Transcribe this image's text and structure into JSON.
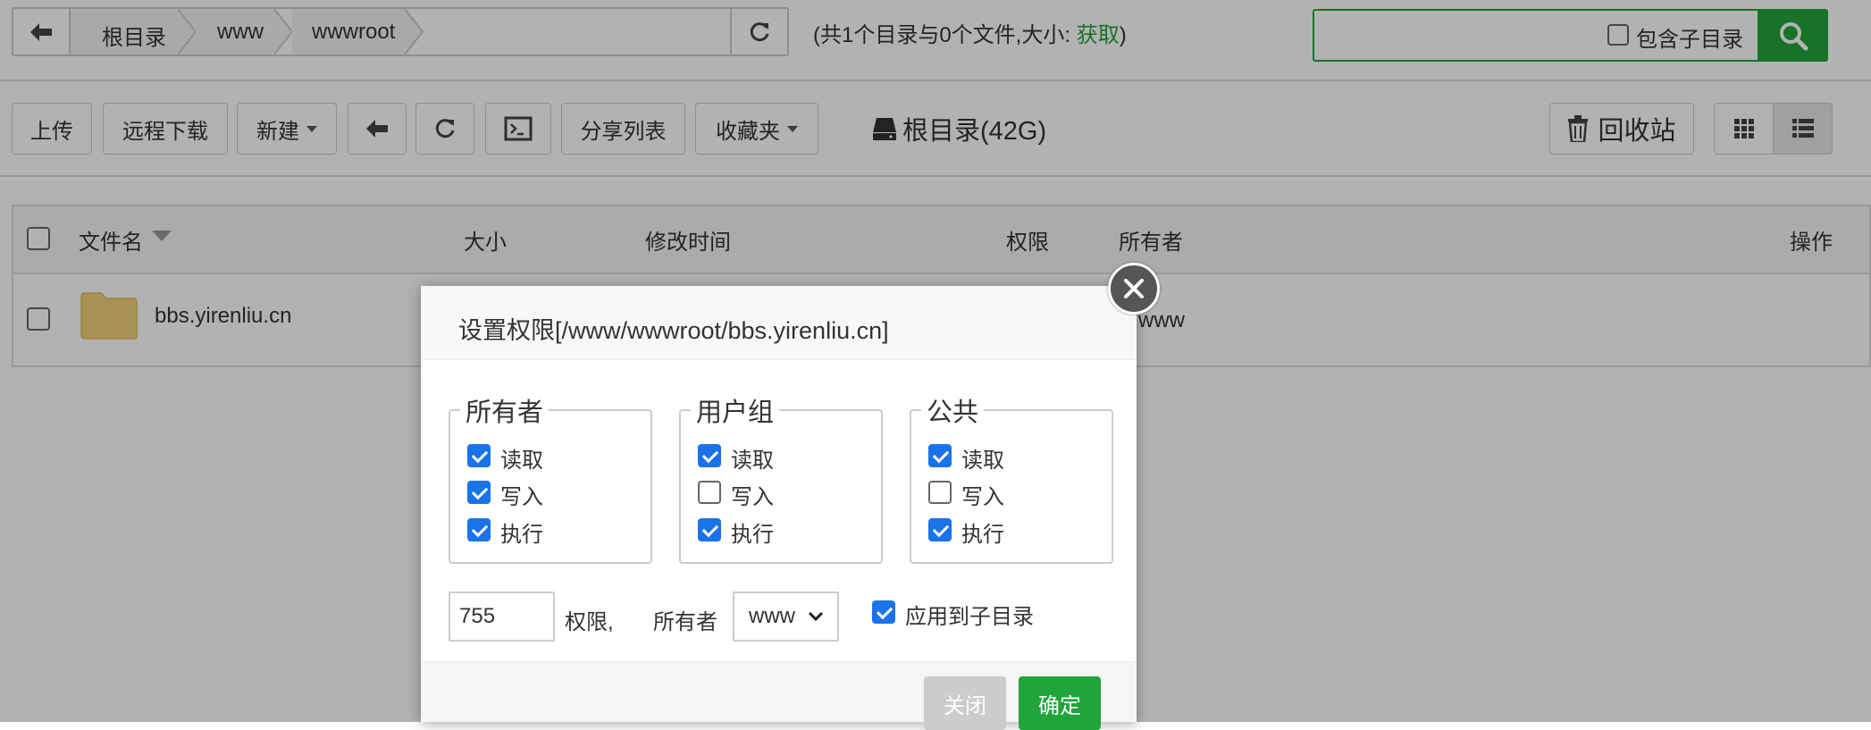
{
  "breadcrumb": {
    "items": [
      "根目录",
      "www",
      "wwwroot"
    ]
  },
  "summary": {
    "prefix": "(共1个目录与0个文件,大小:",
    "link": "获取",
    "suffix": ")"
  },
  "search": {
    "subdir_label": "包含子目录"
  },
  "toolbar": {
    "upload": "上传",
    "remote_download": "远程下载",
    "new": "新建",
    "share_list": "分享列表",
    "favorites": "收藏夹",
    "disk": "根目录(42G)",
    "recycle": "回收站"
  },
  "table": {
    "headers": {
      "name": "文件名",
      "size": "大小",
      "mtime": "修改时间",
      "perm": "权限",
      "owner": "所有者",
      "ops": "操作"
    },
    "rows": [
      {
        "name": "bbs.yirenliu.cn",
        "owner": "www"
      }
    ]
  },
  "dialog": {
    "title": "设置权限[/www/wwwroot/bbs.yirenliu.cn]",
    "groups": [
      {
        "legend": "所有者",
        "perms": [
          {
            "label": "读取",
            "checked": true
          },
          {
            "label": "写入",
            "checked": true
          },
          {
            "label": "执行",
            "checked": true
          }
        ]
      },
      {
        "legend": "用户组",
        "perms": [
          {
            "label": "读取",
            "checked": true
          },
          {
            "label": "写入",
            "checked": false
          },
          {
            "label": "执行",
            "checked": true
          }
        ]
      },
      {
        "legend": "公共",
        "perms": [
          {
            "label": "读取",
            "checked": true
          },
          {
            "label": "写入",
            "checked": false
          },
          {
            "label": "执行",
            "checked": true
          }
        ]
      }
    ],
    "perm_value": "755",
    "perm_label": "权限,",
    "owner_label": "所有者",
    "owner_value": "www",
    "apply_subdir": {
      "label": "应用到子目录",
      "checked": true
    },
    "close_label": "关闭",
    "confirm_label": "确定"
  },
  "colors": {
    "accent_green": "#20a53a",
    "checkbox_blue": "#1a73e8"
  }
}
